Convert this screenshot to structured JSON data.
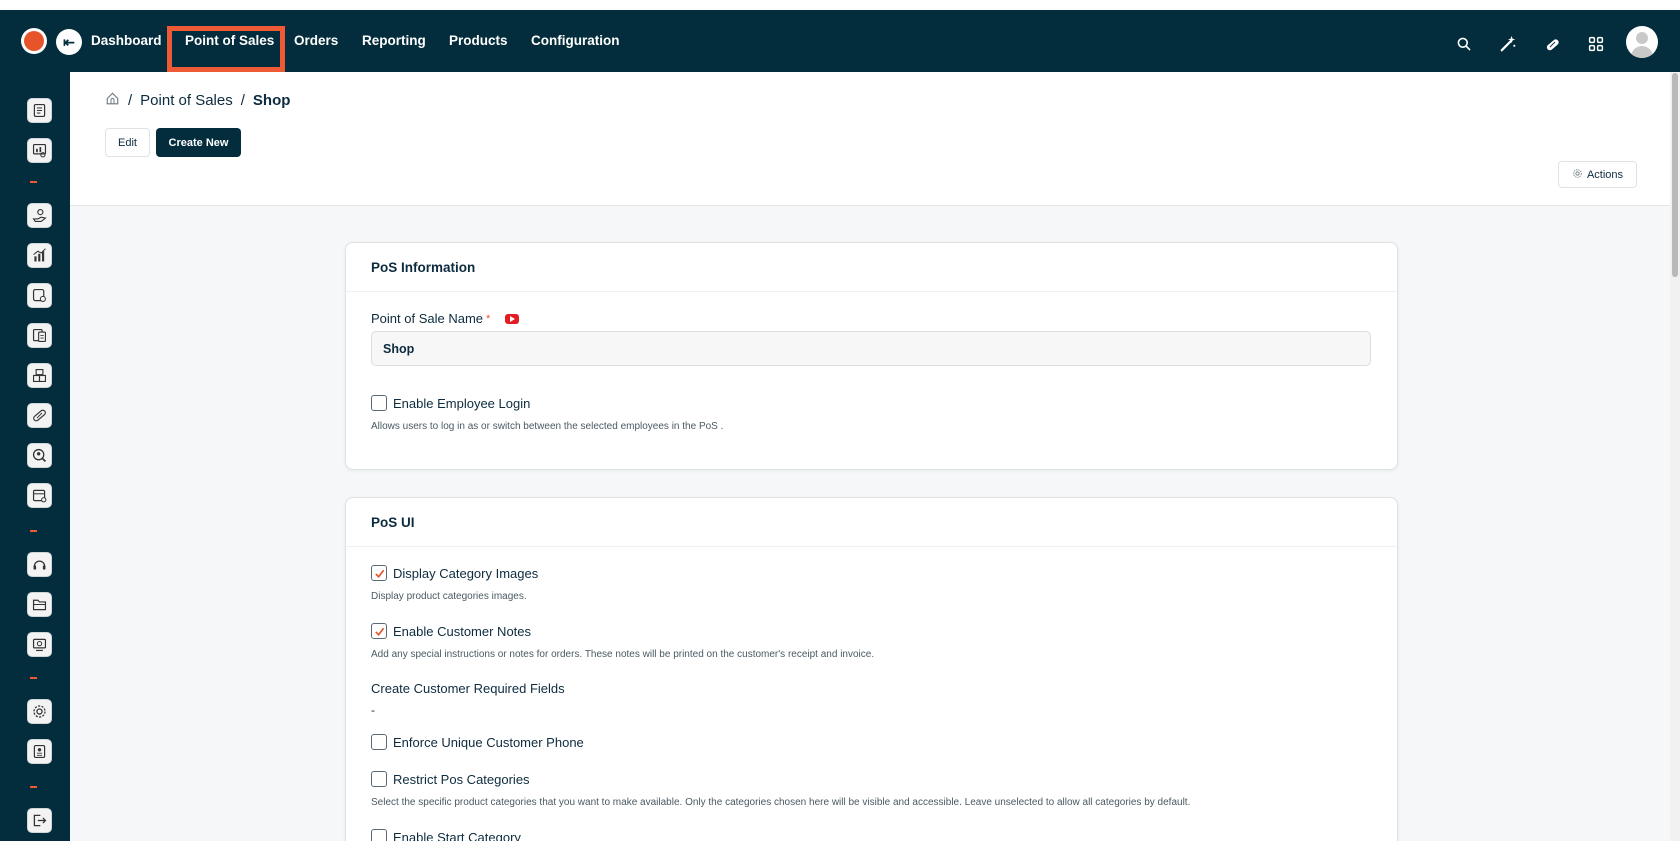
{
  "nav": {
    "collapse_glyph": "⇤",
    "items": [
      {
        "label": "Dashboard"
      },
      {
        "label": "Point of Sales"
      },
      {
        "label": "Orders"
      },
      {
        "label": "Reporting"
      },
      {
        "label": "Products"
      },
      {
        "label": "Configuration"
      }
    ],
    "active_index": 1,
    "right_icons": [
      "search-icon",
      "magic-wand-icon",
      "pill-icon",
      "apps-grid-icon",
      "user-avatar"
    ]
  },
  "sidebar": {
    "icons": [
      "reports-icon",
      "dashboard-chart-icon",
      "sales-hand-icon",
      "analytics-icon",
      "documents-icon",
      "invoices-icon",
      "boxes-icon",
      "pill-icon",
      "search-user-icon",
      "calendar-icon",
      "headset-icon",
      "folder-icon",
      "display-icon",
      "settings-icon",
      "id-card-icon",
      "logout-icon"
    ]
  },
  "breadcrumb": {
    "home_icon": "home-icon",
    "separator": "/",
    "parent": "Point of Sales",
    "current": "Shop"
  },
  "toolbar": {
    "edit_label": "Edit",
    "create_label": "Create New",
    "actions_label": "Actions"
  },
  "pos_information": {
    "title": "PoS Information",
    "name_label": "Point of Sale Name",
    "required_mark": "*",
    "name_value": "Shop",
    "employee_login_label": "Enable Employee Login",
    "employee_login_checked": false,
    "employee_login_help": "Allows users to log in as or switch between the selected employees in the PoS ."
  },
  "pos_ui": {
    "title": "PoS UI",
    "display_category_images_label": "Display Category Images",
    "display_category_images_checked": true,
    "display_category_images_help": "Display product categories images.",
    "customer_notes_label": "Enable Customer Notes",
    "customer_notes_checked": true,
    "customer_notes_help": "Add any special instructions or notes for orders. These notes will be printed on the customer's receipt and invoice.",
    "required_fields_label": "Create Customer Required Fields",
    "required_fields_value": "-",
    "unique_phone_label": "Enforce Unique Customer Phone",
    "unique_phone_checked": false,
    "restrict_categories_label": "Restrict Pos Categories",
    "restrict_categories_checked": false,
    "restrict_categories_help": "Select the specific product categories that you want to make available. Only the categories chosen here will be visible and accessible. Leave unselected to allow all categories by default.",
    "start_category_label": "Enable Start Category",
    "start_category_checked": false
  },
  "colors": {
    "nav_bg": "#032d3c",
    "accent": "#ee5a36",
    "text": "#0d2b3e",
    "page_bg": "#f6f7f8"
  }
}
